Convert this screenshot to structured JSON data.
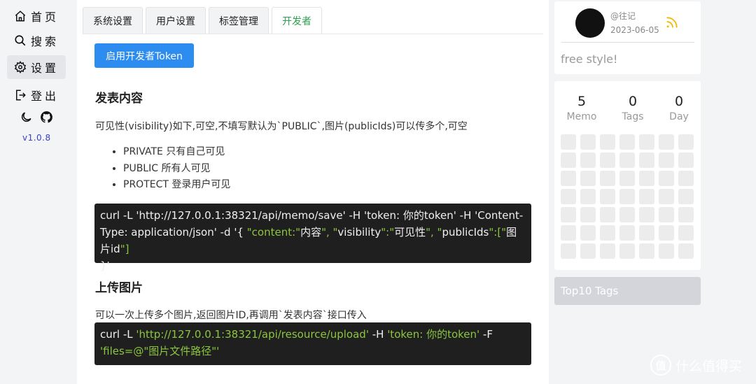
{
  "sidebar": {
    "items": [
      {
        "label": "首页",
        "icon": "home-icon"
      },
      {
        "label": "搜索",
        "icon": "search-icon"
      },
      {
        "label": "设置",
        "icon": "gear-icon"
      },
      {
        "label": "登出",
        "icon": "logout-icon"
      }
    ],
    "active_item": "设置",
    "version": "v1.0.8"
  },
  "tabs": [
    "系统设置",
    "用户设置",
    "标签管理",
    "开发者"
  ],
  "active_tab": "开发者",
  "main": {
    "token_button": "启用开发者Token",
    "section1": {
      "title": "发表内容",
      "desc": "可见性(visibility)如下,可空,不填写默认为`PUBLIC`,图片(publicIds)可以传多个,可空",
      "list": [
        "PRIVATE 只有自己可见",
        "PUBLIC 所有人可见",
        "PROTECT 登录用户可见"
      ],
      "code": {
        "a": "curl -L 'http://127.0.0.1:38321/api/memo/save' -H 'token: 你的token' -H 'Content-Type: application/json' -d '{ ",
        "b": "\"content:\"",
        "c": "内容",
        "d": "\", \"",
        "e": "visibility",
        "f": "\":\"",
        "g": "可见性",
        "h": "\", \"",
        "i": "publicIds",
        "j": "\":[\"",
        "k": "图片id",
        "l": "\"]",
        "m": "}'"
      }
    },
    "section2": {
      "title": "上传图片",
      "desc": "可以一次上传多个图片,返回图片ID,再调用`发表内容`接口传入",
      "code": {
        "a": "curl -L ",
        "b": "'http://127.0.0.1:38321/api/resource/upload'",
        "c": " -H ",
        "d": "'token: 你的token'",
        "e": " -F",
        "f": "'files=@\"图片文件路径\"'"
      }
    }
  },
  "profile": {
    "username": "@往记",
    "date": "2023-06-05",
    "motto": "free style!"
  },
  "stats": [
    {
      "num": "5",
      "label": "Memo"
    },
    {
      "num": "0",
      "label": "Tags"
    },
    {
      "num": "0",
      "label": "Day"
    }
  ],
  "top10_title": "Top10 Tags",
  "watermark": {
    "logo": "值",
    "text": "什么值得买"
  },
  "colors": {
    "accent": "#2d8cf0",
    "active_tab": "#2e9e4f",
    "code_bg": "#1f1f1f",
    "code_string": "#8cc63f",
    "version": "#3b3fc9"
  }
}
